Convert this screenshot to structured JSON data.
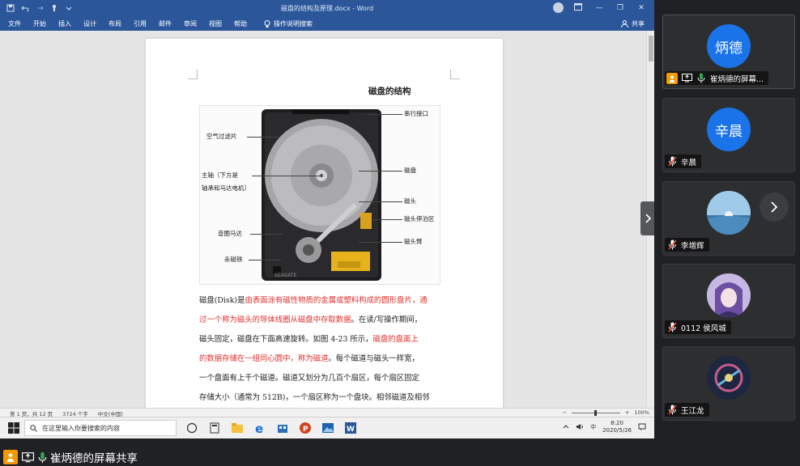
{
  "word": {
    "doc_title": "磁盘的结构及原理.docx  -  Word",
    "window_buttons": [
      "—",
      "❐",
      "✕"
    ],
    "ribbon_tabs": [
      "文件",
      "开始",
      "插入",
      "设计",
      "布局",
      "引用",
      "邮件",
      "审阅",
      "视图",
      "帮助"
    ],
    "tell_me": "操作说明搜索",
    "share_label": "共享",
    "page": {
      "heading": "磁盘的结构",
      "figure_labels": {
        "serial_port": "串行接口",
        "air_filter": "空气过滤片",
        "spindle_line1": "主轴（下方是",
        "spindle_line2": "轴承和马达电机）",
        "platter": "磁盘",
        "head": "磁头",
        "head_park": "磁头停泊区",
        "voice_coil": "音圈马达",
        "head_arm": "磁头臂",
        "magnet": "永磁铁",
        "watermark": "SEAGATE"
      },
      "body_lines": [
        [
          {
            "t": "磁盘(Disk)是",
            "red": false
          },
          {
            "t": "由表面涂有磁性物质的金属或塑料构成的圆形盘片，通",
            "red": true
          }
        ],
        [
          {
            "t": "过一个称为磁头的导体线圈从磁盘中存取数据",
            "red": true
          },
          {
            "t": "。在读/写操作期间，",
            "red": false
          }
        ],
        [
          {
            "t": "磁头固定，磁盘在下面高速旋转。如图 4-23 所示，",
            "red": false
          },
          {
            "t": "磁盘的盘面上",
            "red": true
          }
        ],
        [
          {
            "t": "的数据存储在一组同心圆中，称为磁道",
            "red": true
          },
          {
            "t": "。每个磁道与磁头一样宽，",
            "red": false
          }
        ],
        [
          {
            "t": "一个盘面有上千个磁道。磁道又划分为几百个扇区，每个扇区固定",
            "red": false
          }
        ],
        [
          {
            "t": "存储大小（通常为 512B)，一个扇区称为一个盘块。相邻磁道及相邻",
            "red": false
          }
        ]
      ]
    },
    "status": {
      "page": "第 1 页，共 12 页",
      "words": "3724 个字",
      "language": "中文(中国)",
      "zoom": "100%"
    }
  },
  "taskbar": {
    "search_placeholder": "在这里输入你要搜索的内容",
    "ime": "中",
    "time": "8:20",
    "date": "2020/5/26"
  },
  "participants": [
    {
      "name": "崔炳德的屏幕...",
      "avatar_text": "炳德",
      "avatar_color": "#1a73e8",
      "presenting": true
    },
    {
      "name": "辛晨",
      "avatar_text": "辛晨",
      "avatar_color": "#1a73e8",
      "presenting": false
    },
    {
      "name": "李增辉",
      "avatar_text": "",
      "avatar_color": "#6fa7d2",
      "presenting": false
    },
    {
      "name": "0112 侯风城",
      "avatar_text": "",
      "avatar_color": "#b9a5d8",
      "presenting": false
    },
    {
      "name": "王江龙",
      "avatar_text": "",
      "avatar_color": "#26304a",
      "presenting": false
    }
  ],
  "sharing_banner": "崔炳德的屏幕共享",
  "colors": {
    "word_blue": "#2b579a",
    "meeting_bg": "#202124",
    "avatar_blue": "#1a73e8",
    "highlight_red": "#e0302d",
    "mic_green": "#34a853"
  }
}
